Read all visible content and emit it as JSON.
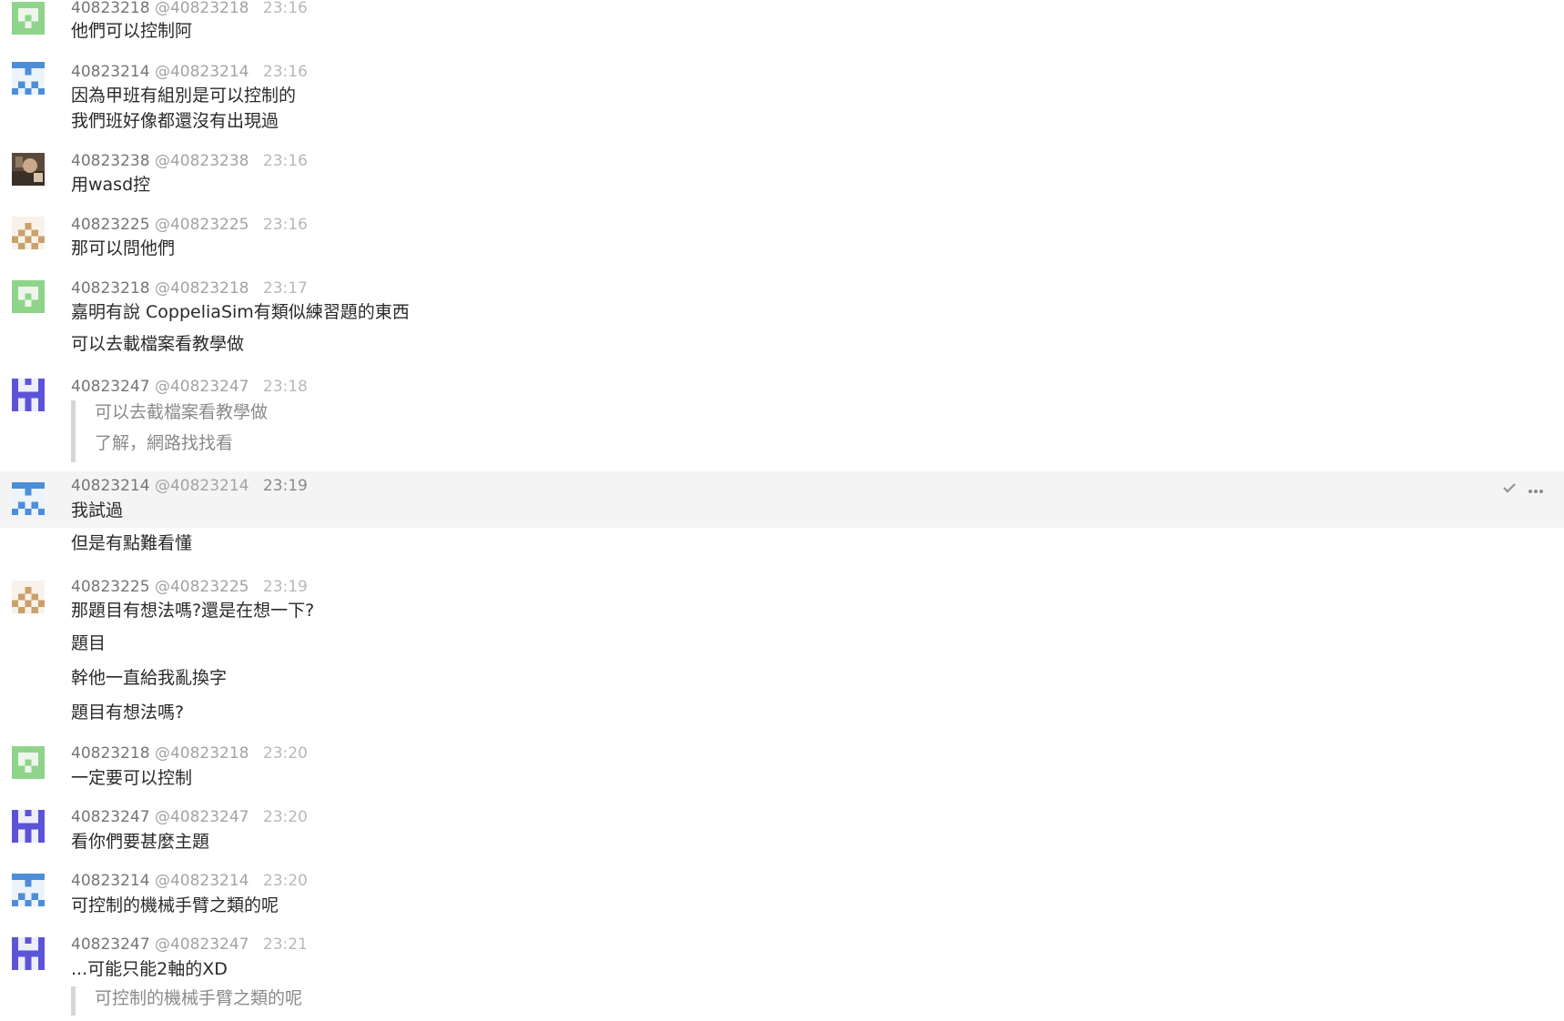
{
  "icons": {
    "check": "check-icon",
    "more": "more-horizontal-icon"
  },
  "colors": {
    "green_avatar": "#8fd48a",
    "blue_avatar": "#4c8ed8",
    "brown_avatar": "#caa06a",
    "purple_avatar": "#5c54d6",
    "quote_bar": "#d6d6d6",
    "hover_bg": "#f4f4f5"
  },
  "messages": [
    {
      "user": "40823218",
      "handle": "@40823218",
      "time": "23:16",
      "avatar": "green",
      "lines": [
        "他們可以控制阿"
      ]
    },
    {
      "user": "40823214",
      "handle": "@40823214",
      "time": "23:16",
      "avatar": "blue",
      "lines": [
        "因為甲班有組別是可以控制的",
        "我們班好像都還沒有出現過"
      ]
    },
    {
      "user": "40823238",
      "handle": "@40823238",
      "time": "23:16",
      "avatar": "photo",
      "lines": [
        "用wasd控"
      ]
    },
    {
      "user": "40823225",
      "handle": "@40823225",
      "time": "23:16",
      "avatar": "brown",
      "lines": [
        "那可以問他們"
      ]
    },
    {
      "user": "40823218",
      "handle": "@40823218",
      "time": "23:17",
      "avatar": "green",
      "lines": [
        "嘉明有說 CoppeliaSim有類似練習題的東西",
        "可以去載檔案看教學做"
      ]
    },
    {
      "user": "40823247",
      "handle": "@40823247",
      "time": "23:18",
      "avatar": "purple",
      "quote": [
        "可以去截檔案看教學做",
        "了解，網路找找看"
      ]
    },
    {
      "user": "40823214",
      "handle": "@40823214",
      "time": "23:19",
      "avatar": "blue",
      "lines": [
        "我試過",
        "但是有點難看懂"
      ]
    },
    {
      "user": "40823225",
      "handle": "@40823225",
      "time": "23:19",
      "avatar": "brown",
      "lines": [
        "那題目有想法嗎?還是在想一下?",
        "題目",
        "幹他一直給我亂換字",
        "題目有想法嗎?"
      ]
    },
    {
      "user": "40823218",
      "handle": "@40823218",
      "time": "23:20",
      "avatar": "green",
      "lines": [
        "一定要可以控制"
      ]
    },
    {
      "user": "40823247",
      "handle": "@40823247",
      "time": "23:20",
      "avatar": "purple",
      "lines": [
        "看你們要甚麼主題"
      ]
    },
    {
      "user": "40823214",
      "handle": "@40823214",
      "time": "23:20",
      "avatar": "blue",
      "lines": [
        "可控制的機械手臂之類的呢"
      ]
    },
    {
      "user": "40823247",
      "handle": "@40823247",
      "time": "23:21",
      "avatar": "purple",
      "lines": [
        "...可能只能2軸的XD"
      ],
      "quote": [
        "可控制的機械手臂之類的呢"
      ]
    }
  ]
}
